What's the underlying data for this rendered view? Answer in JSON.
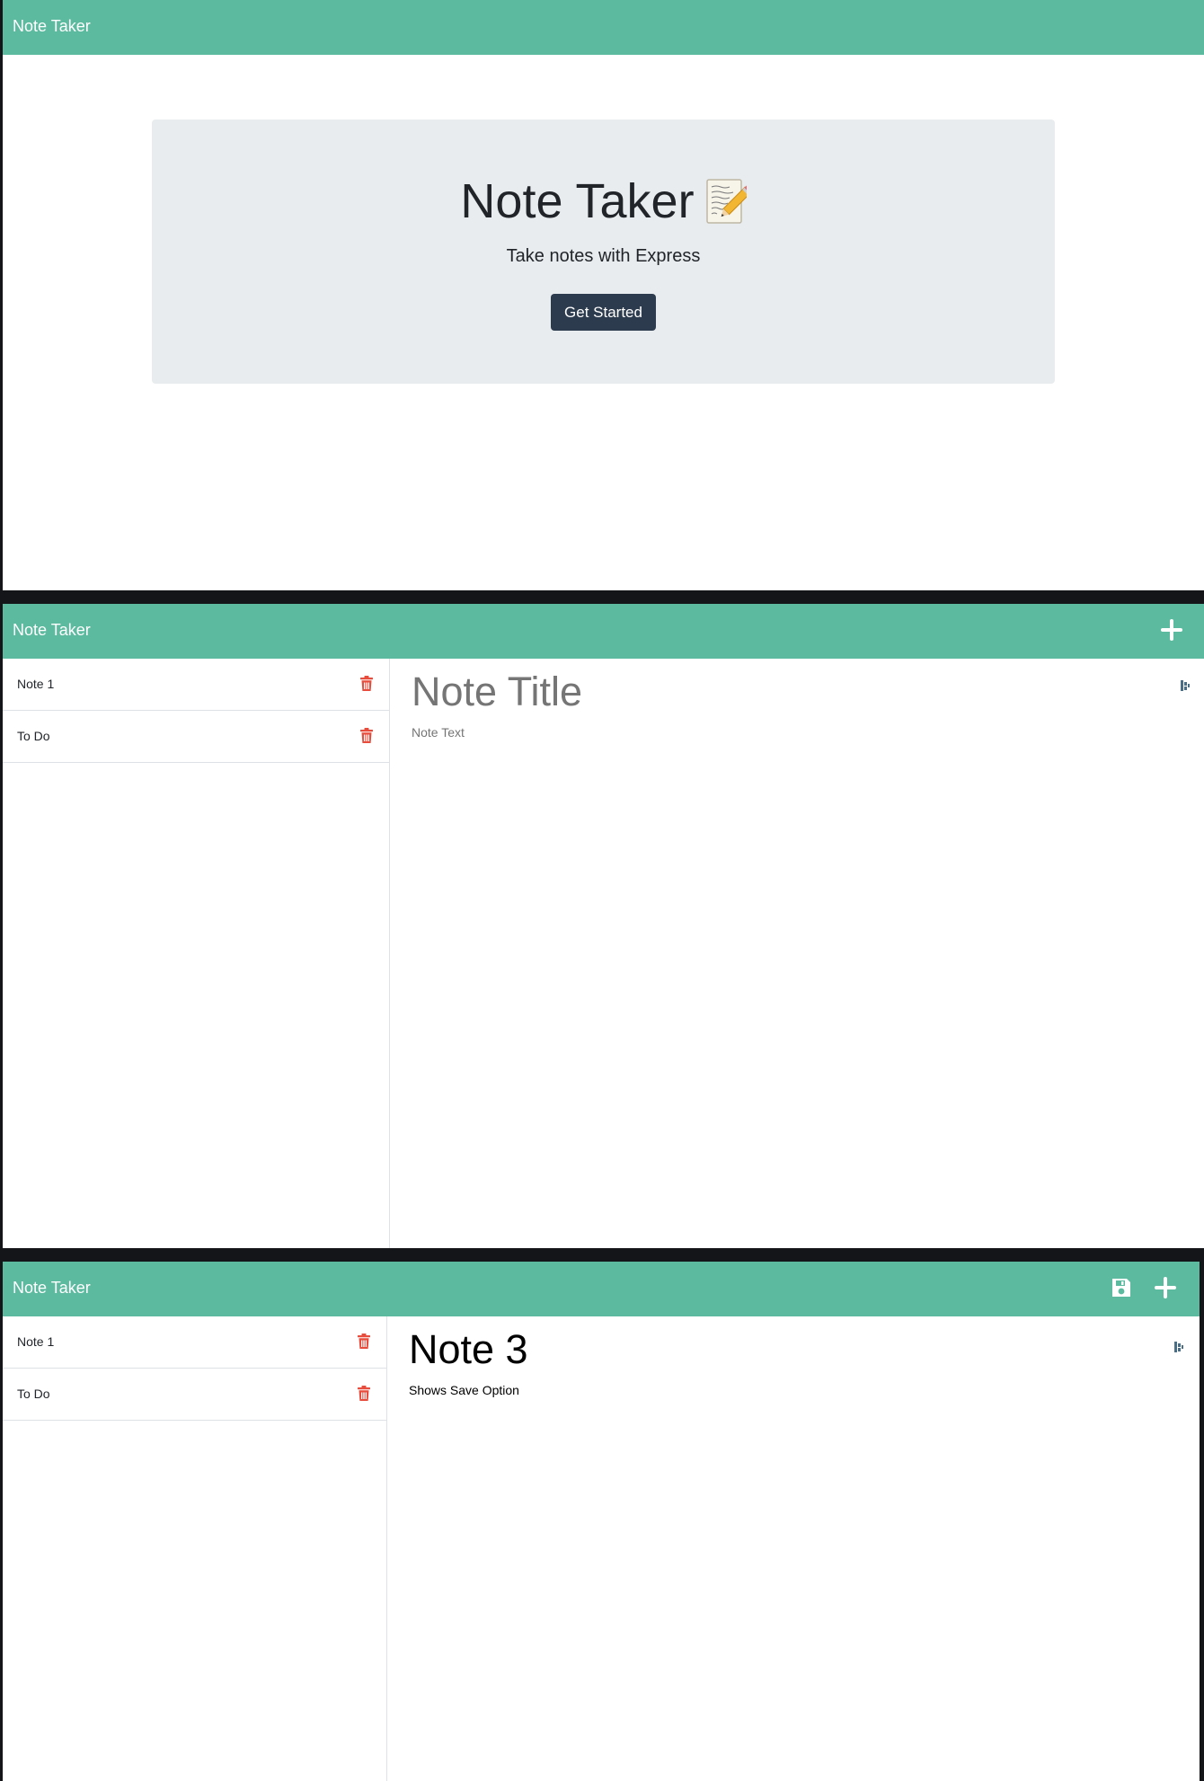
{
  "landing": {
    "navbar": {
      "brand": "Note Taker"
    },
    "hero": {
      "title": "Note Taker",
      "emoji_icon": "memo-icon",
      "subtitle": "Take notes with Express",
      "button_label": "Get Started"
    }
  },
  "notes_empty": {
    "navbar": {
      "brand": "Note Taker",
      "add_icon": "plus-icon"
    },
    "notes": [
      {
        "title": "Note 1",
        "delete_icon": "trash-icon"
      },
      {
        "title": "To Do",
        "delete_icon": "trash-icon"
      }
    ],
    "editor": {
      "title_value": "",
      "title_placeholder": "Note Title",
      "text_value": "",
      "text_placeholder": "Note Text"
    }
  },
  "notes_editing": {
    "navbar": {
      "brand": "Note Taker",
      "save_icon": "save-icon",
      "add_icon": "plus-icon"
    },
    "notes": [
      {
        "title": "Note 1",
        "delete_icon": "trash-icon"
      },
      {
        "title": "To Do",
        "delete_icon": "trash-icon"
      }
    ],
    "editor": {
      "title_value": "Note 3",
      "title_placeholder": "Note Title",
      "text_value": "Shows Save Option",
      "text_placeholder": "Note Text"
    }
  },
  "colors": {
    "navbar": "#5cba9e",
    "jumbotron": "#e9ecef",
    "button_dark": "#2d3b4e",
    "trash": "#e74c3c",
    "placeholder": "#757575"
  }
}
